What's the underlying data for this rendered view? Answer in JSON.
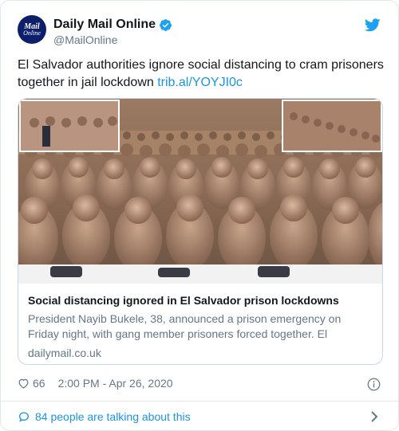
{
  "tweet": {
    "avatar": {
      "line1": "Mail",
      "line2": "Online",
      "icon": "daily-mail-logo"
    },
    "display_name": "Daily Mail Online",
    "handle": "@MailOnline",
    "verified_icon": "verified-badge-icon",
    "platform_icon": "twitter-bird-icon",
    "text": "El Salvador authorities ignore social distancing to cram prisoners together in jail lockdown",
    "link": "trib.al/YOYJI0c",
    "card": {
      "media_description": "image",
      "title": "Social distancing ignored in El Salvador prison lockdowns",
      "description": "President Nayib Bukele, 38, announced a prison emergency on Friday night, with gang member prisoners forced together. El",
      "domain": "dailymail.co.uk"
    },
    "likes": "66",
    "timestamp": "2:00 PM - Apr 26, 2020",
    "footer_text": "84 people are talking about this"
  },
  "colors": {
    "link": "#1b95e0",
    "verified": "#1da1f2",
    "muted": "#657786",
    "text": "#14171a"
  }
}
